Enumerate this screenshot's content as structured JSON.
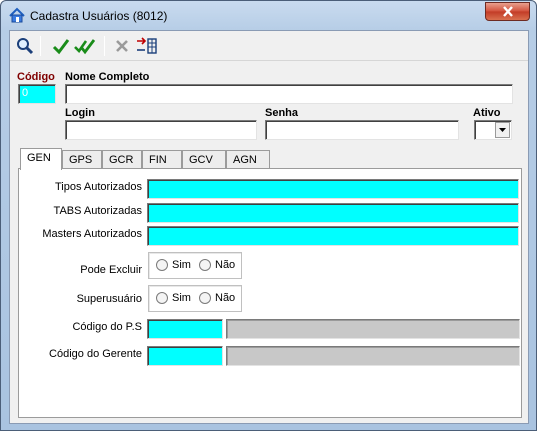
{
  "window": {
    "title": "Cadastra Usuários (8012)"
  },
  "toolbar": {
    "icons": [
      "search-icon",
      "confirm-check-icon",
      "confirm-all-check-icon",
      "cancel-x-icon",
      "columns-settings-icon"
    ]
  },
  "header": {
    "codigo_label": "Código",
    "codigo_value": "0",
    "nome_label": "Nome Completo",
    "nome_value": "",
    "login_label": "Login",
    "login_value": "",
    "senha_label": "Senha",
    "senha_value": "",
    "ativo_label": "Ativo",
    "ativo_value": ""
  },
  "tabs": [
    {
      "label": "GEN",
      "active": true
    },
    {
      "label": "GPS"
    },
    {
      "label": "GCR"
    },
    {
      "label": "FIN"
    },
    {
      "label": "GCV"
    },
    {
      "label": "AGN"
    }
  ],
  "gen": {
    "tipos_label": "Tipos Autorizados",
    "tipos_value": "",
    "tabs_label": "TABS Autorizadas",
    "tabs_value": "",
    "masters_label": "Masters Autorizados",
    "masters_value": "",
    "pode_excluir_label": "Pode Excluir",
    "superusuario_label": "Superusuário",
    "sim_label": "Sim",
    "nao_label": "Não",
    "codigo_ps_label": "Código do P.S",
    "codigo_ps_value": "",
    "codigo_ps_desc": "",
    "codigo_gerente_label": "Código do Gerente",
    "codigo_gerente_value": "",
    "codigo_gerente_desc": ""
  },
  "colors": {
    "required_field": "#00ffff",
    "readonly_field": "#c8c8c8",
    "key_label": "#800000"
  }
}
